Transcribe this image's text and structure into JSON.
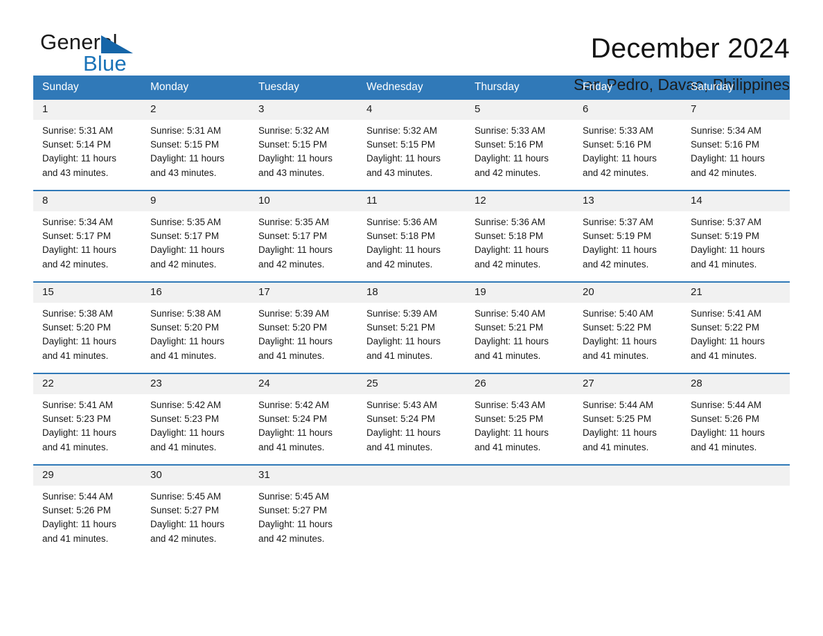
{
  "brand": {
    "word_general": "General",
    "word_blue": "Blue",
    "triangle_color": "#1565a8"
  },
  "header": {
    "title": "December 2024",
    "subtitle": "San Pedro, Davao, Philippines"
  },
  "colors": {
    "header_blue": "#3079b8",
    "row_divider_blue": "#2f78b7",
    "daynum_background": "#f1f1f1",
    "text": "#181818"
  },
  "weekday_headers": [
    "Sunday",
    "Monday",
    "Tuesday",
    "Wednesday",
    "Thursday",
    "Friday",
    "Saturday"
  ],
  "weeks": [
    [
      {
        "day": "1",
        "sunrise": "Sunrise: 5:31 AM",
        "sunset": "Sunset: 5:14 PM",
        "daylight_line1": "Daylight: 11 hours",
        "daylight_line2": "and 43 minutes."
      },
      {
        "day": "2",
        "sunrise": "Sunrise: 5:31 AM",
        "sunset": "Sunset: 5:15 PM",
        "daylight_line1": "Daylight: 11 hours",
        "daylight_line2": "and 43 minutes."
      },
      {
        "day": "3",
        "sunrise": "Sunrise: 5:32 AM",
        "sunset": "Sunset: 5:15 PM",
        "daylight_line1": "Daylight: 11 hours",
        "daylight_line2": "and 43 minutes."
      },
      {
        "day": "4",
        "sunrise": "Sunrise: 5:32 AM",
        "sunset": "Sunset: 5:15 PM",
        "daylight_line1": "Daylight: 11 hours",
        "daylight_line2": "and 43 minutes."
      },
      {
        "day": "5",
        "sunrise": "Sunrise: 5:33 AM",
        "sunset": "Sunset: 5:16 PM",
        "daylight_line1": "Daylight: 11 hours",
        "daylight_line2": "and 42 minutes."
      },
      {
        "day": "6",
        "sunrise": "Sunrise: 5:33 AM",
        "sunset": "Sunset: 5:16 PM",
        "daylight_line1": "Daylight: 11 hours",
        "daylight_line2": "and 42 minutes."
      },
      {
        "day": "7",
        "sunrise": "Sunrise: 5:34 AM",
        "sunset": "Sunset: 5:16 PM",
        "daylight_line1": "Daylight: 11 hours",
        "daylight_line2": "and 42 minutes."
      }
    ],
    [
      {
        "day": "8",
        "sunrise": "Sunrise: 5:34 AM",
        "sunset": "Sunset: 5:17 PM",
        "daylight_line1": "Daylight: 11 hours",
        "daylight_line2": "and 42 minutes."
      },
      {
        "day": "9",
        "sunrise": "Sunrise: 5:35 AM",
        "sunset": "Sunset: 5:17 PM",
        "daylight_line1": "Daylight: 11 hours",
        "daylight_line2": "and 42 minutes."
      },
      {
        "day": "10",
        "sunrise": "Sunrise: 5:35 AM",
        "sunset": "Sunset: 5:17 PM",
        "daylight_line1": "Daylight: 11 hours",
        "daylight_line2": "and 42 minutes."
      },
      {
        "day": "11",
        "sunrise": "Sunrise: 5:36 AM",
        "sunset": "Sunset: 5:18 PM",
        "daylight_line1": "Daylight: 11 hours",
        "daylight_line2": "and 42 minutes."
      },
      {
        "day": "12",
        "sunrise": "Sunrise: 5:36 AM",
        "sunset": "Sunset: 5:18 PM",
        "daylight_line1": "Daylight: 11 hours",
        "daylight_line2": "and 42 minutes."
      },
      {
        "day": "13",
        "sunrise": "Sunrise: 5:37 AM",
        "sunset": "Sunset: 5:19 PM",
        "daylight_line1": "Daylight: 11 hours",
        "daylight_line2": "and 42 minutes."
      },
      {
        "day": "14",
        "sunrise": "Sunrise: 5:37 AM",
        "sunset": "Sunset: 5:19 PM",
        "daylight_line1": "Daylight: 11 hours",
        "daylight_line2": "and 41 minutes."
      }
    ],
    [
      {
        "day": "15",
        "sunrise": "Sunrise: 5:38 AM",
        "sunset": "Sunset: 5:20 PM",
        "daylight_line1": "Daylight: 11 hours",
        "daylight_line2": "and 41 minutes."
      },
      {
        "day": "16",
        "sunrise": "Sunrise: 5:38 AM",
        "sunset": "Sunset: 5:20 PM",
        "daylight_line1": "Daylight: 11 hours",
        "daylight_line2": "and 41 minutes."
      },
      {
        "day": "17",
        "sunrise": "Sunrise: 5:39 AM",
        "sunset": "Sunset: 5:20 PM",
        "daylight_line1": "Daylight: 11 hours",
        "daylight_line2": "and 41 minutes."
      },
      {
        "day": "18",
        "sunrise": "Sunrise: 5:39 AM",
        "sunset": "Sunset: 5:21 PM",
        "daylight_line1": "Daylight: 11 hours",
        "daylight_line2": "and 41 minutes."
      },
      {
        "day": "19",
        "sunrise": "Sunrise: 5:40 AM",
        "sunset": "Sunset: 5:21 PM",
        "daylight_line1": "Daylight: 11 hours",
        "daylight_line2": "and 41 minutes."
      },
      {
        "day": "20",
        "sunrise": "Sunrise: 5:40 AM",
        "sunset": "Sunset: 5:22 PM",
        "daylight_line1": "Daylight: 11 hours",
        "daylight_line2": "and 41 minutes."
      },
      {
        "day": "21",
        "sunrise": "Sunrise: 5:41 AM",
        "sunset": "Sunset: 5:22 PM",
        "daylight_line1": "Daylight: 11 hours",
        "daylight_line2": "and 41 minutes."
      }
    ],
    [
      {
        "day": "22",
        "sunrise": "Sunrise: 5:41 AM",
        "sunset": "Sunset: 5:23 PM",
        "daylight_line1": "Daylight: 11 hours",
        "daylight_line2": "and 41 minutes."
      },
      {
        "day": "23",
        "sunrise": "Sunrise: 5:42 AM",
        "sunset": "Sunset: 5:23 PM",
        "daylight_line1": "Daylight: 11 hours",
        "daylight_line2": "and 41 minutes."
      },
      {
        "day": "24",
        "sunrise": "Sunrise: 5:42 AM",
        "sunset": "Sunset: 5:24 PM",
        "daylight_line1": "Daylight: 11 hours",
        "daylight_line2": "and 41 minutes."
      },
      {
        "day": "25",
        "sunrise": "Sunrise: 5:43 AM",
        "sunset": "Sunset: 5:24 PM",
        "daylight_line1": "Daylight: 11 hours",
        "daylight_line2": "and 41 minutes."
      },
      {
        "day": "26",
        "sunrise": "Sunrise: 5:43 AM",
        "sunset": "Sunset: 5:25 PM",
        "daylight_line1": "Daylight: 11 hours",
        "daylight_line2": "and 41 minutes."
      },
      {
        "day": "27",
        "sunrise": "Sunrise: 5:44 AM",
        "sunset": "Sunset: 5:25 PM",
        "daylight_line1": "Daylight: 11 hours",
        "daylight_line2": "and 41 minutes."
      },
      {
        "day": "28",
        "sunrise": "Sunrise: 5:44 AM",
        "sunset": "Sunset: 5:26 PM",
        "daylight_line1": "Daylight: 11 hours",
        "daylight_line2": "and 41 minutes."
      }
    ],
    [
      {
        "day": "29",
        "sunrise": "Sunrise: 5:44 AM",
        "sunset": "Sunset: 5:26 PM",
        "daylight_line1": "Daylight: 11 hours",
        "daylight_line2": "and 41 minutes."
      },
      {
        "day": "30",
        "sunrise": "Sunrise: 5:45 AM",
        "sunset": "Sunset: 5:27 PM",
        "daylight_line1": "Daylight: 11 hours",
        "daylight_line2": "and 42 minutes."
      },
      {
        "day": "31",
        "sunrise": "Sunrise: 5:45 AM",
        "sunset": "Sunset: 5:27 PM",
        "daylight_line1": "Daylight: 11 hours",
        "daylight_line2": "and 42 minutes."
      },
      {
        "day": "",
        "sunrise": "",
        "sunset": "",
        "daylight_line1": "",
        "daylight_line2": ""
      },
      {
        "day": "",
        "sunrise": "",
        "sunset": "",
        "daylight_line1": "",
        "daylight_line2": ""
      },
      {
        "day": "",
        "sunrise": "",
        "sunset": "",
        "daylight_line1": "",
        "daylight_line2": ""
      },
      {
        "day": "",
        "sunrise": "",
        "sunset": "",
        "daylight_line1": "",
        "daylight_line2": ""
      }
    ]
  ]
}
